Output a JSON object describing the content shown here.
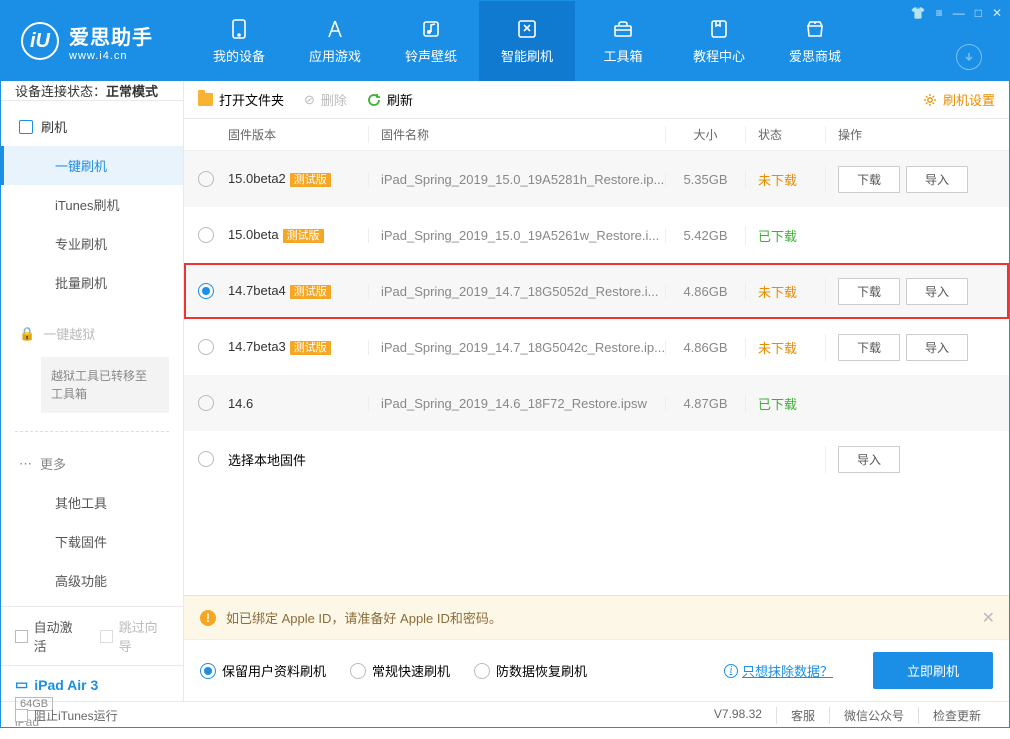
{
  "brand": {
    "cn": "爱思助手",
    "en": "www.i4.cn",
    "logo_letter": "iU"
  },
  "nav": [
    {
      "id": "device",
      "label": "我的设备"
    },
    {
      "id": "apps",
      "label": "应用游戏"
    },
    {
      "id": "ringtone",
      "label": "铃声壁纸"
    },
    {
      "id": "flash",
      "label": "智能刷机",
      "active": true
    },
    {
      "id": "toolbox",
      "label": "工具箱"
    },
    {
      "id": "tutorial",
      "label": "教程中心"
    },
    {
      "id": "store",
      "label": "爱思商城"
    }
  ],
  "sidebar": {
    "conn_label": "设备连接状态：",
    "conn_value": "正常模式",
    "section_flash": "刷机",
    "items": [
      "一键刷机",
      "iTunes刷机",
      "专业刷机",
      "批量刷机"
    ],
    "jailbreak_hd": "一键越狱",
    "jailbreak_note": "越狱工具已转移至工具箱",
    "section_more": "更多",
    "more_items": [
      "其他工具",
      "下载固件",
      "高级功能"
    ],
    "auto_activate": "自动激活",
    "skip_guide": "跳过向导",
    "device_name": "iPad Air 3",
    "device_capacity": "64GB",
    "device_type": "iPad"
  },
  "toolbar": {
    "open": "打开文件夹",
    "delete": "删除",
    "refresh": "刷新",
    "settings": "刷机设置"
  },
  "columns": {
    "ver": "固件版本",
    "name": "固件名称",
    "size": "大小",
    "status": "状态",
    "ops": "操作"
  },
  "status_labels": {
    "not_downloaded": "未下载",
    "downloaded": "已下载"
  },
  "op_labels": {
    "download": "下载",
    "import": "导入"
  },
  "badge_beta": "测试版",
  "rows": [
    {
      "selected": false,
      "ver": "15.0beta2",
      "beta": true,
      "name": "iPad_Spring_2019_15.0_19A5281h_Restore.ip...",
      "size": "5.35GB",
      "status": "not_downloaded",
      "ops": [
        "download",
        "import"
      ]
    },
    {
      "selected": false,
      "ver": "15.0beta",
      "beta": true,
      "name": "iPad_Spring_2019_15.0_19A5261w_Restore.i...",
      "size": "5.42GB",
      "status": "downloaded",
      "ops": []
    },
    {
      "selected": true,
      "ver": "14.7beta4",
      "beta": true,
      "name": "iPad_Spring_2019_14.7_18G5052d_Restore.i...",
      "size": "4.86GB",
      "status": "not_downloaded",
      "ops": [
        "download",
        "import"
      ],
      "highlight": true
    },
    {
      "selected": false,
      "ver": "14.7beta3",
      "beta": true,
      "name": "iPad_Spring_2019_14.7_18G5042c_Restore.ip...",
      "size": "4.86GB",
      "status": "not_downloaded",
      "ops": [
        "download",
        "import"
      ]
    },
    {
      "selected": false,
      "ver": "14.6",
      "beta": false,
      "name": "iPad_Spring_2019_14.6_18F72_Restore.ipsw",
      "size": "4.87GB",
      "status": "downloaded",
      "ops": []
    }
  ],
  "local_row_label": "选择本地固件",
  "notice": "如已绑定 Apple ID，请准备好 Apple ID和密码。",
  "flash_options": [
    {
      "id": "keep",
      "label": "保留用户资料刷机",
      "selected": true
    },
    {
      "id": "fast",
      "label": "常规快速刷机",
      "selected": false
    },
    {
      "id": "recover",
      "label": "防数据恢复刷机",
      "selected": false
    }
  ],
  "erase_link": "只想抹除数据？",
  "primary_btn": "立即刷机",
  "statusbar": {
    "block_itunes": "阻止iTunes运行",
    "version": "V7.98.32",
    "service": "客服",
    "wechat": "微信公众号",
    "update": "检查更新"
  }
}
